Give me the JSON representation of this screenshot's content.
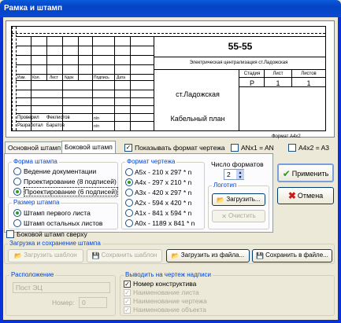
{
  "window": {
    "title": "Рамка и штамп"
  },
  "preview": {
    "designation": "55-55",
    "subtitle": "Электрическая централизация ст.Ладожская",
    "station": "ст.Ладожская",
    "sheet_name": "Кабельный план",
    "format_label": "Формат А4х2",
    "col_headers": [
      "Изм.",
      "Кол.",
      "Лист",
      "Nдок",
      "Подпись",
      "Дата"
    ],
    "stage_header": "Стадия",
    "sheet_header": "Лист",
    "sheets_header": "Листов",
    "stage_value": "Р",
    "sheet_value": "1",
    "sheets_value": "1",
    "signatures": [
      {
        "role": "Проверил",
        "name": "Феклистов",
        "sign": "п/п"
      },
      {
        "role": "Разработал",
        "name": "Баратов",
        "sign": "п/п"
      }
    ]
  },
  "tabs": [
    {
      "label": "Основной штамп"
    },
    {
      "label": "Боковой штамп"
    }
  ],
  "show_format": {
    "label": "Показывать формат чертежа",
    "checked": true
  },
  "anx1": {
    "label": "ANx1 = AN",
    "checked": false
  },
  "a4x2": {
    "label": "A4x2 = A3",
    "checked": false
  },
  "stamp_form": {
    "title": "Форма штампа",
    "options": [
      "Ведение документации",
      "Проектирование (8 подписей)",
      "Проектирование (6 подписей)"
    ],
    "selected": 2
  },
  "stamp_size": {
    "title": "Размер штампа",
    "options": [
      "Штамп первого листа",
      "Штамп остальных листов"
    ],
    "selected": 0
  },
  "drawing_format": {
    "title": "Формат чертежа",
    "options": [
      "А5х - 210 х 297 * n",
      "А4х - 297 х 210 * n",
      "А3х - 420 х 297 * n",
      "А2х - 594 х 420 * n",
      "А1х - 841 х 594 * n",
      "А0х - 1189 х 841 * n"
    ],
    "selected": 1
  },
  "format_count": {
    "title": "Число форматов",
    "value": "2"
  },
  "logo": {
    "title": "Логотип",
    "load_label": "Загрузить...",
    "clear_label": "Очистить"
  },
  "apply_label": "Применить",
  "cancel_label": "Отмена",
  "side_stamp_top": {
    "label": "Боковой штамп сверху",
    "checked": false
  },
  "load_save": {
    "title": "Загрузка и сохранение штампа",
    "load_template": "Загрузить шаблон",
    "save_template": "Сохранить шаблон",
    "load_file": "Загрузить из файла...",
    "save_file": "Сохранить в файле..."
  },
  "location": {
    "title": "Расположение",
    "post_value": "Пост ЭЦ",
    "number_label": "Номер:",
    "number_value": "0"
  },
  "output": {
    "title": "Выводить на чертеж надписи",
    "items": [
      {
        "label": "Номер конструктива",
        "checked": true,
        "enabled": true
      },
      {
        "label": "Наименование листа",
        "checked": true,
        "enabled": false
      },
      {
        "label": "Наименование чертежа",
        "checked": true,
        "enabled": false
      },
      {
        "label": "Наименование объекта",
        "checked": true,
        "enabled": false
      }
    ]
  }
}
